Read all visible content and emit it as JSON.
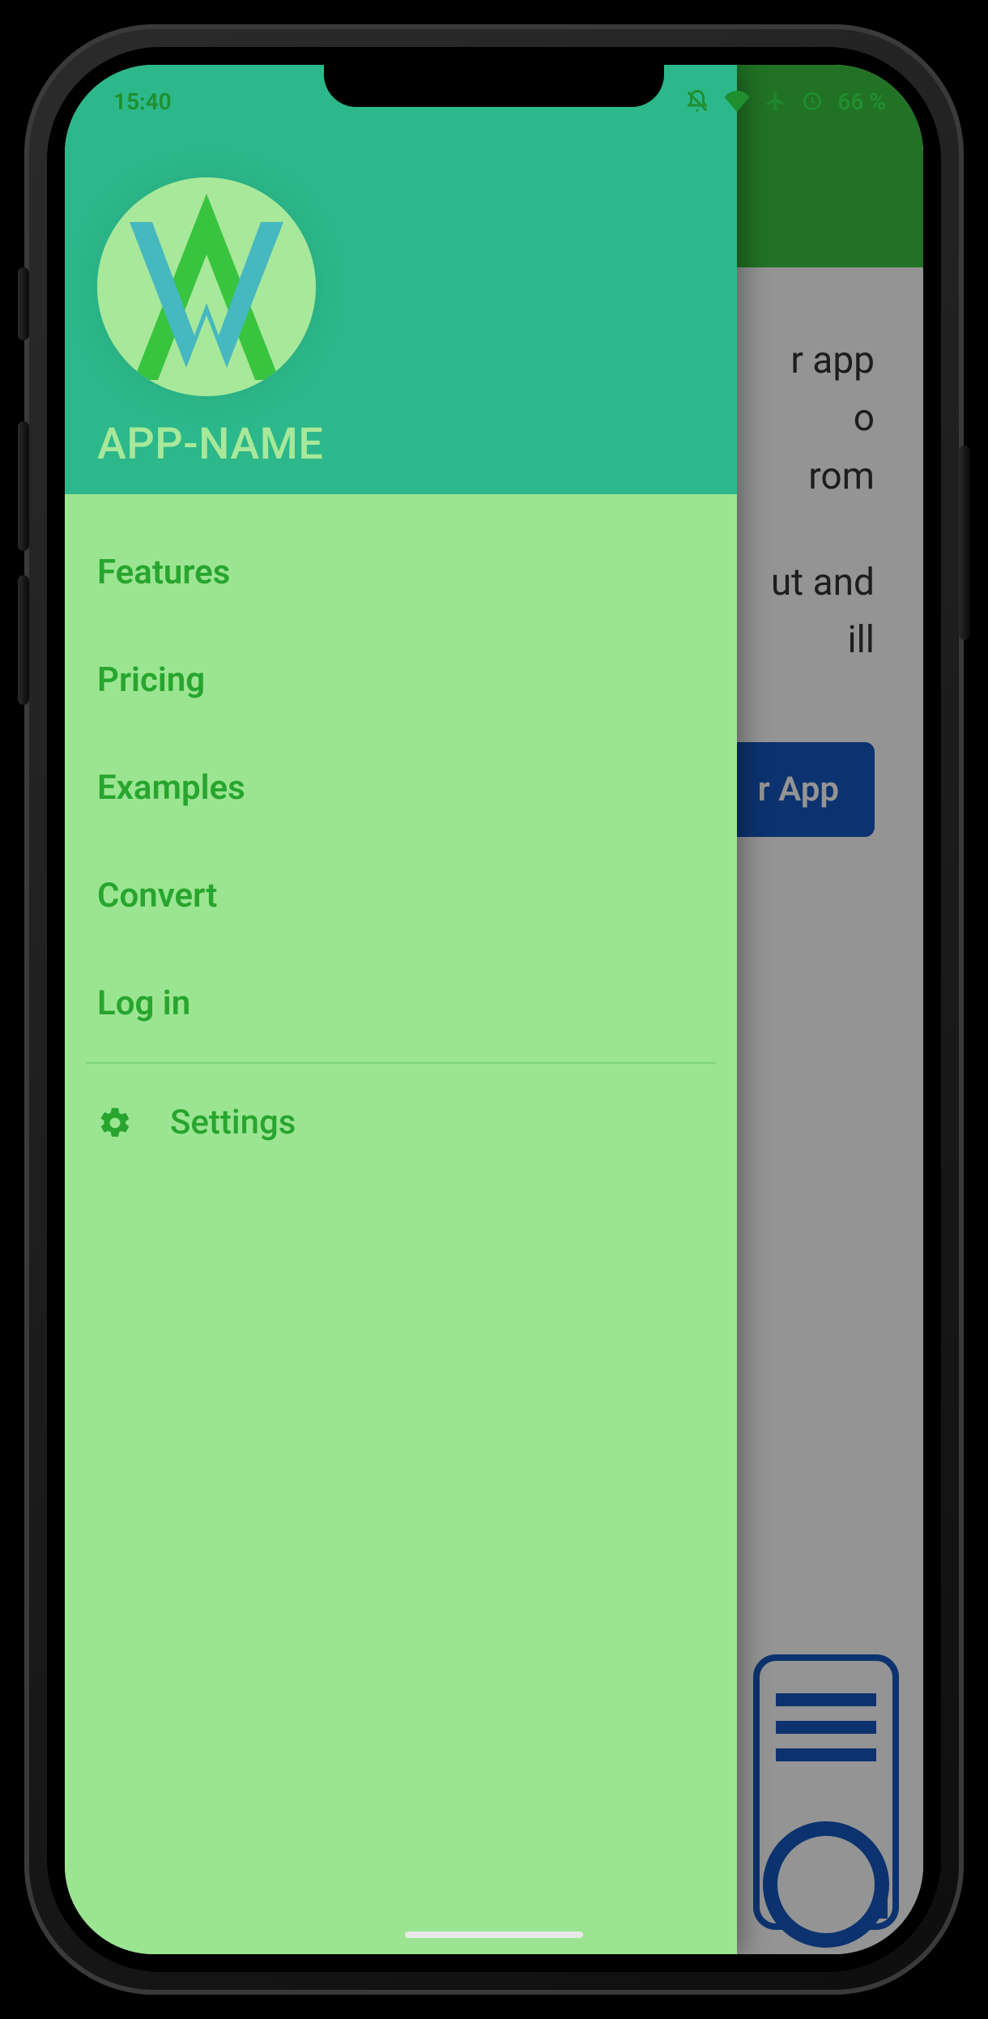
{
  "status_bar": {
    "time": "15:40",
    "battery_text": "66 %"
  },
  "drawer": {
    "app_name": "APP-NAME",
    "items": [
      {
        "label": "Features"
      },
      {
        "label": "Pricing"
      },
      {
        "label": "Examples"
      },
      {
        "label": "Convert"
      },
      {
        "label": "Log in"
      }
    ],
    "settings_label": "Settings"
  },
  "background": {
    "text_fragment_1": "r app",
    "text_fragment_2": "o",
    "text_fragment_3": "rom",
    "text_fragment_4": "ut and",
    "text_fragment_5": "ill",
    "button_fragment": "r App"
  }
}
